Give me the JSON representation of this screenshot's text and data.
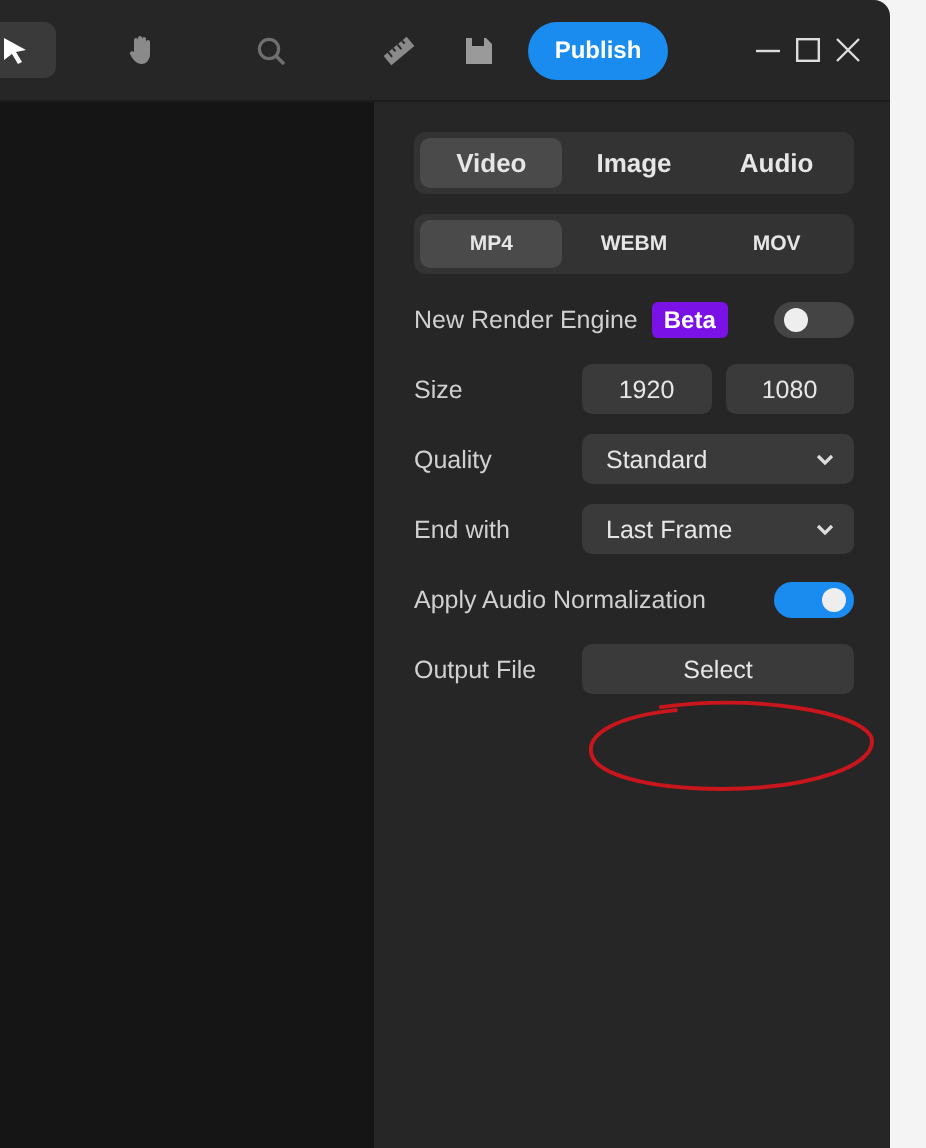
{
  "toolbar": {
    "tools": [
      {
        "kind": "pointer",
        "selected": true
      },
      {
        "kind": "hand",
        "selected": false
      },
      {
        "kind": "zoom",
        "selected": false
      },
      {
        "kind": "ruler",
        "selected": false
      }
    ],
    "publish": "Publish"
  },
  "media_tabs": [
    {
      "label": "Video",
      "selected": true
    },
    {
      "label": "Image",
      "selected": false
    },
    {
      "label": "Audio",
      "selected": false
    }
  ],
  "format_tabs": [
    {
      "label": "MP4",
      "selected": true
    },
    {
      "label": "WEBM",
      "selected": false
    },
    {
      "label": "MOV",
      "selected": false
    }
  ],
  "settings": [
    {
      "kind": "toggle",
      "label": "New Render Engine",
      "badge": "Beta",
      "on": false
    },
    {
      "kind": "pair",
      "label": "Size",
      "values": [
        "1920",
        "1080"
      ]
    },
    {
      "kind": "select",
      "label": "Quality",
      "value": "Standard"
    },
    {
      "kind": "select",
      "label": "End with",
      "value": "Last Frame"
    },
    {
      "kind": "toggle",
      "label": "Apply Audio Normalization",
      "on": true
    },
    {
      "kind": "button",
      "label": "Output File",
      "button": "Select"
    }
  ]
}
